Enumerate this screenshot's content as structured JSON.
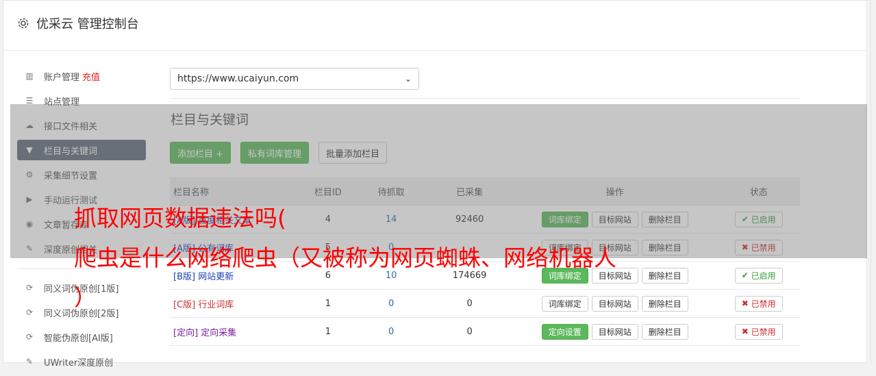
{
  "header": {
    "title": "优采云 管理控制台"
  },
  "sidebar": {
    "items": [
      {
        "label": "账户管理",
        "extra": "充值",
        "icon": "bar-chart-icon"
      },
      {
        "label": "站点管理",
        "icon": "server-icon"
      },
      {
        "label": "接口文件相关",
        "icon": "cloud-upload-icon"
      },
      {
        "label": "栏目与关键词",
        "icon": "filter-icon",
        "active": true
      },
      {
        "label": "采集细节设置",
        "icon": "cogs-icon"
      },
      {
        "label": "手动运行测试",
        "icon": "play-circle-icon"
      },
      {
        "label": "文章暂存库",
        "icon": "database-icon"
      },
      {
        "label": "深度原创相关",
        "icon": "edit-icon"
      }
    ],
    "items2": [
      {
        "label": "同义词伪原创[1版]",
        "icon": "refresh-icon"
      },
      {
        "label": "同义词伪原创[2版]",
        "icon": "refresh-icon"
      },
      {
        "label": "智能伪原创[AI版]",
        "icon": "refresh-icon"
      },
      {
        "label": "UWriter深度原创",
        "icon": "edit-icon"
      }
    ]
  },
  "site_select": {
    "value": "https://www.ucaiyun.com"
  },
  "section_title": "栏目与关键词",
  "buttons": {
    "add": "添加栏目 +",
    "private": "私有词库管理",
    "batch": "批量添加栏目"
  },
  "table": {
    "headers": [
      "栏目名称",
      "栏目ID",
      "待抓取",
      "已采集",
      "操作",
      "状态"
    ],
    "rows": [
      {
        "name": "[A版] 百度相关文章",
        "id": "4",
        "pending": "14",
        "collected": "92460",
        "op1": "词库绑定",
        "op1_style": "green",
        "op2": "目标网站",
        "op3": "删除栏目",
        "status": "已启用",
        "status_on": true,
        "name_color": "blue"
      },
      {
        "name": "[A版] 公有词库",
        "id": "5",
        "pending": "0",
        "collected": "",
        "op1": "词库绑定",
        "op1_style": "default",
        "op2": "目标网站",
        "op3": "删除栏目",
        "status": "已禁用",
        "status_on": false,
        "name_color": "blue"
      },
      {
        "name": "[B版] 网站更新",
        "id": "6",
        "pending": "10",
        "collected": "174669",
        "op1": "词库绑定",
        "op1_style": "green",
        "op2": "目标网站",
        "op3": "删除栏目",
        "status": "已启用",
        "status_on": true,
        "name_color": "blue"
      },
      {
        "name": "[C版] 行业词库",
        "id": "1",
        "pending": "0",
        "collected": "0",
        "op1": "词库绑定",
        "op1_style": "default",
        "op2": "目标网站",
        "op3": "删除栏目",
        "status": "已禁用",
        "status_on": false,
        "name_color": "red"
      },
      {
        "name": "[定向] 定向采集",
        "id": "1",
        "pending": "0",
        "collected": "0",
        "op1": "定向设置",
        "op1_style": "green",
        "op2": "目标网站",
        "op3": "删除栏目",
        "status": "已禁用",
        "status_on": false,
        "name_color": "purple"
      }
    ]
  },
  "overlay": {
    "line1": "抓取网页数据违法吗(",
    "line2": "爬虫是什么网络爬虫（又被称为网页蜘蛛、网络机器人",
    "line3": "）"
  },
  "colors": {
    "green": "#5cb85c",
    "active_nav": "#606a7a",
    "overlay_text": "#ff0000"
  }
}
